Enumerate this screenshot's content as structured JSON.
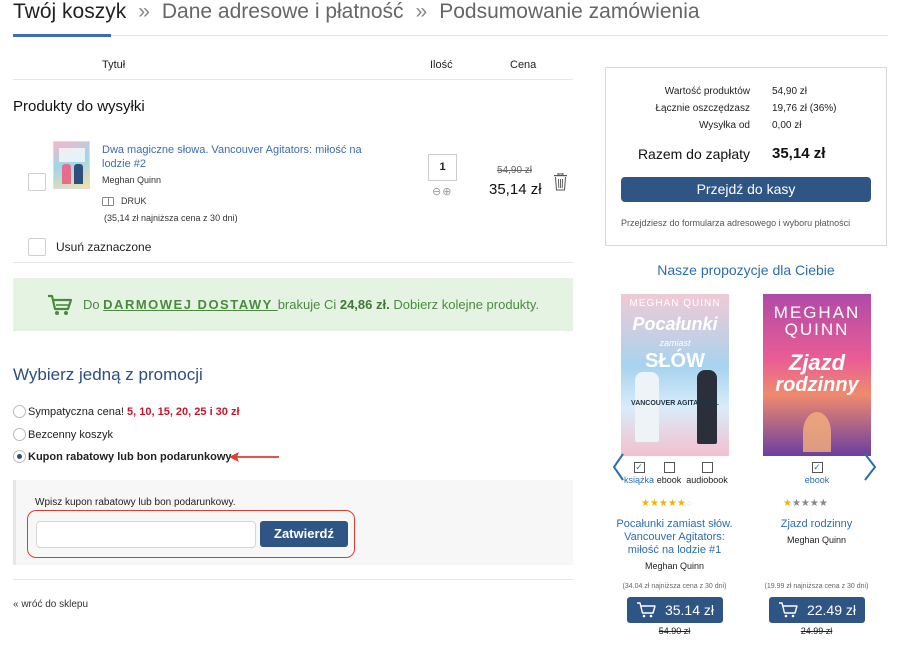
{
  "breadcrumb": {
    "step1": "Twój koszyk",
    "separator": "»",
    "step2": "Dane adresowe i płatność",
    "step3": "Podsumowanie zamówienia"
  },
  "table_header": {
    "title": "Tytuł",
    "quantity": "Ilość",
    "price": "Cena"
  },
  "products_section": "Produkty do wysyłki",
  "product": {
    "title": "Dwa magiczne słowa. Vancouver Agitators: miłość na lodzie #2",
    "author": "Meghan Quinn",
    "format": "DRUK",
    "lowest_price_note": "(35,14 zł najniższa cena z 30 dni)",
    "quantity": "1",
    "quantity_controls": "⊖⊕",
    "old_price": "54,90 zł",
    "new_price": "35,14 zł"
  },
  "remove_selected": "Usuń zaznaczone",
  "free_delivery": {
    "prefix": "Do ",
    "link": "DARMOWEJ DOSTAWY ",
    "middle": "brakuje Ci ",
    "amount": "24,86 zł.",
    "suffix": " Dobierz kolejne produkty."
  },
  "promotions": {
    "heading": "Wybierz jedną z promocji",
    "option1_label": "Sympatyczna cena!",
    "option1_highlight": "5, 10, 15, 20, 25 i 30 zł",
    "option2_label": "Bezcenny koszyk",
    "option3_label": "Kupon rabatowy lub bon podarunkowy",
    "selected_option": 3
  },
  "coupon": {
    "label": "Wpisz kupon rabatowy lub bon podarunkowy.",
    "input_value": "",
    "submit": "Zatwierdź"
  },
  "back_link": "«  wróć do sklepu",
  "summary": {
    "products_value_label": "Wartość produktów",
    "products_value": "54,90 zł",
    "savings_label": "Łącznie oszczędzasz",
    "savings": "19,76 zł (36%)",
    "shipping_label": "Wysyłka od",
    "shipping": "0,00 zł",
    "total_label": "Razem do zapłaty",
    "total": "35,14 zł",
    "checkout": "Przejdź do kasy",
    "checkout_note": "Przejdziesz do formularza adresowego i wyboru płatności"
  },
  "recommendations": {
    "heading": "Nasze propozycje dla Ciebie",
    "items": [
      {
        "cover_author": "MEGHAN QUINN",
        "cover_title": "Pocałunki",
        "cover_title2": "zamiast",
        "cover_title3": "SŁÓW",
        "cover_sub": "VANCOUVER AGITATORS.",
        "formats": [
          "książka",
          "ebook",
          "audiobook"
        ],
        "selected_format": "książka",
        "stars": 5,
        "title": "Pocałunki zamiast słów. Vancouver Agitators: miłość na lodzie #1",
        "author": "Meghan Quinn",
        "lowest": "(34.04 zł najniższa cena z 30 dni)",
        "price": "35.14 zł",
        "old_price": "54.90 zł"
      },
      {
        "cover_author": "MEGHAN QUINN",
        "cover_title": "Zjazd",
        "cover_title2": "rodzinny",
        "formats": [
          "ebook"
        ],
        "selected_format": "ebook",
        "stars": 1,
        "title": "Zjazd rodzinny",
        "author": "Meghan Quinn",
        "lowest": "(19.99 zł najniższa cena z 30 dni)",
        "price": "22.49 zł",
        "old_price": "24.99 zł"
      }
    ]
  },
  "colors": {
    "primary": "#2f5585",
    "link": "#2b6fae",
    "promo_bg": "#e5f4e2",
    "promo_text": "#4a8a3f",
    "highlight_red": "#d0112b",
    "annotation_red": "#e23b2e"
  }
}
